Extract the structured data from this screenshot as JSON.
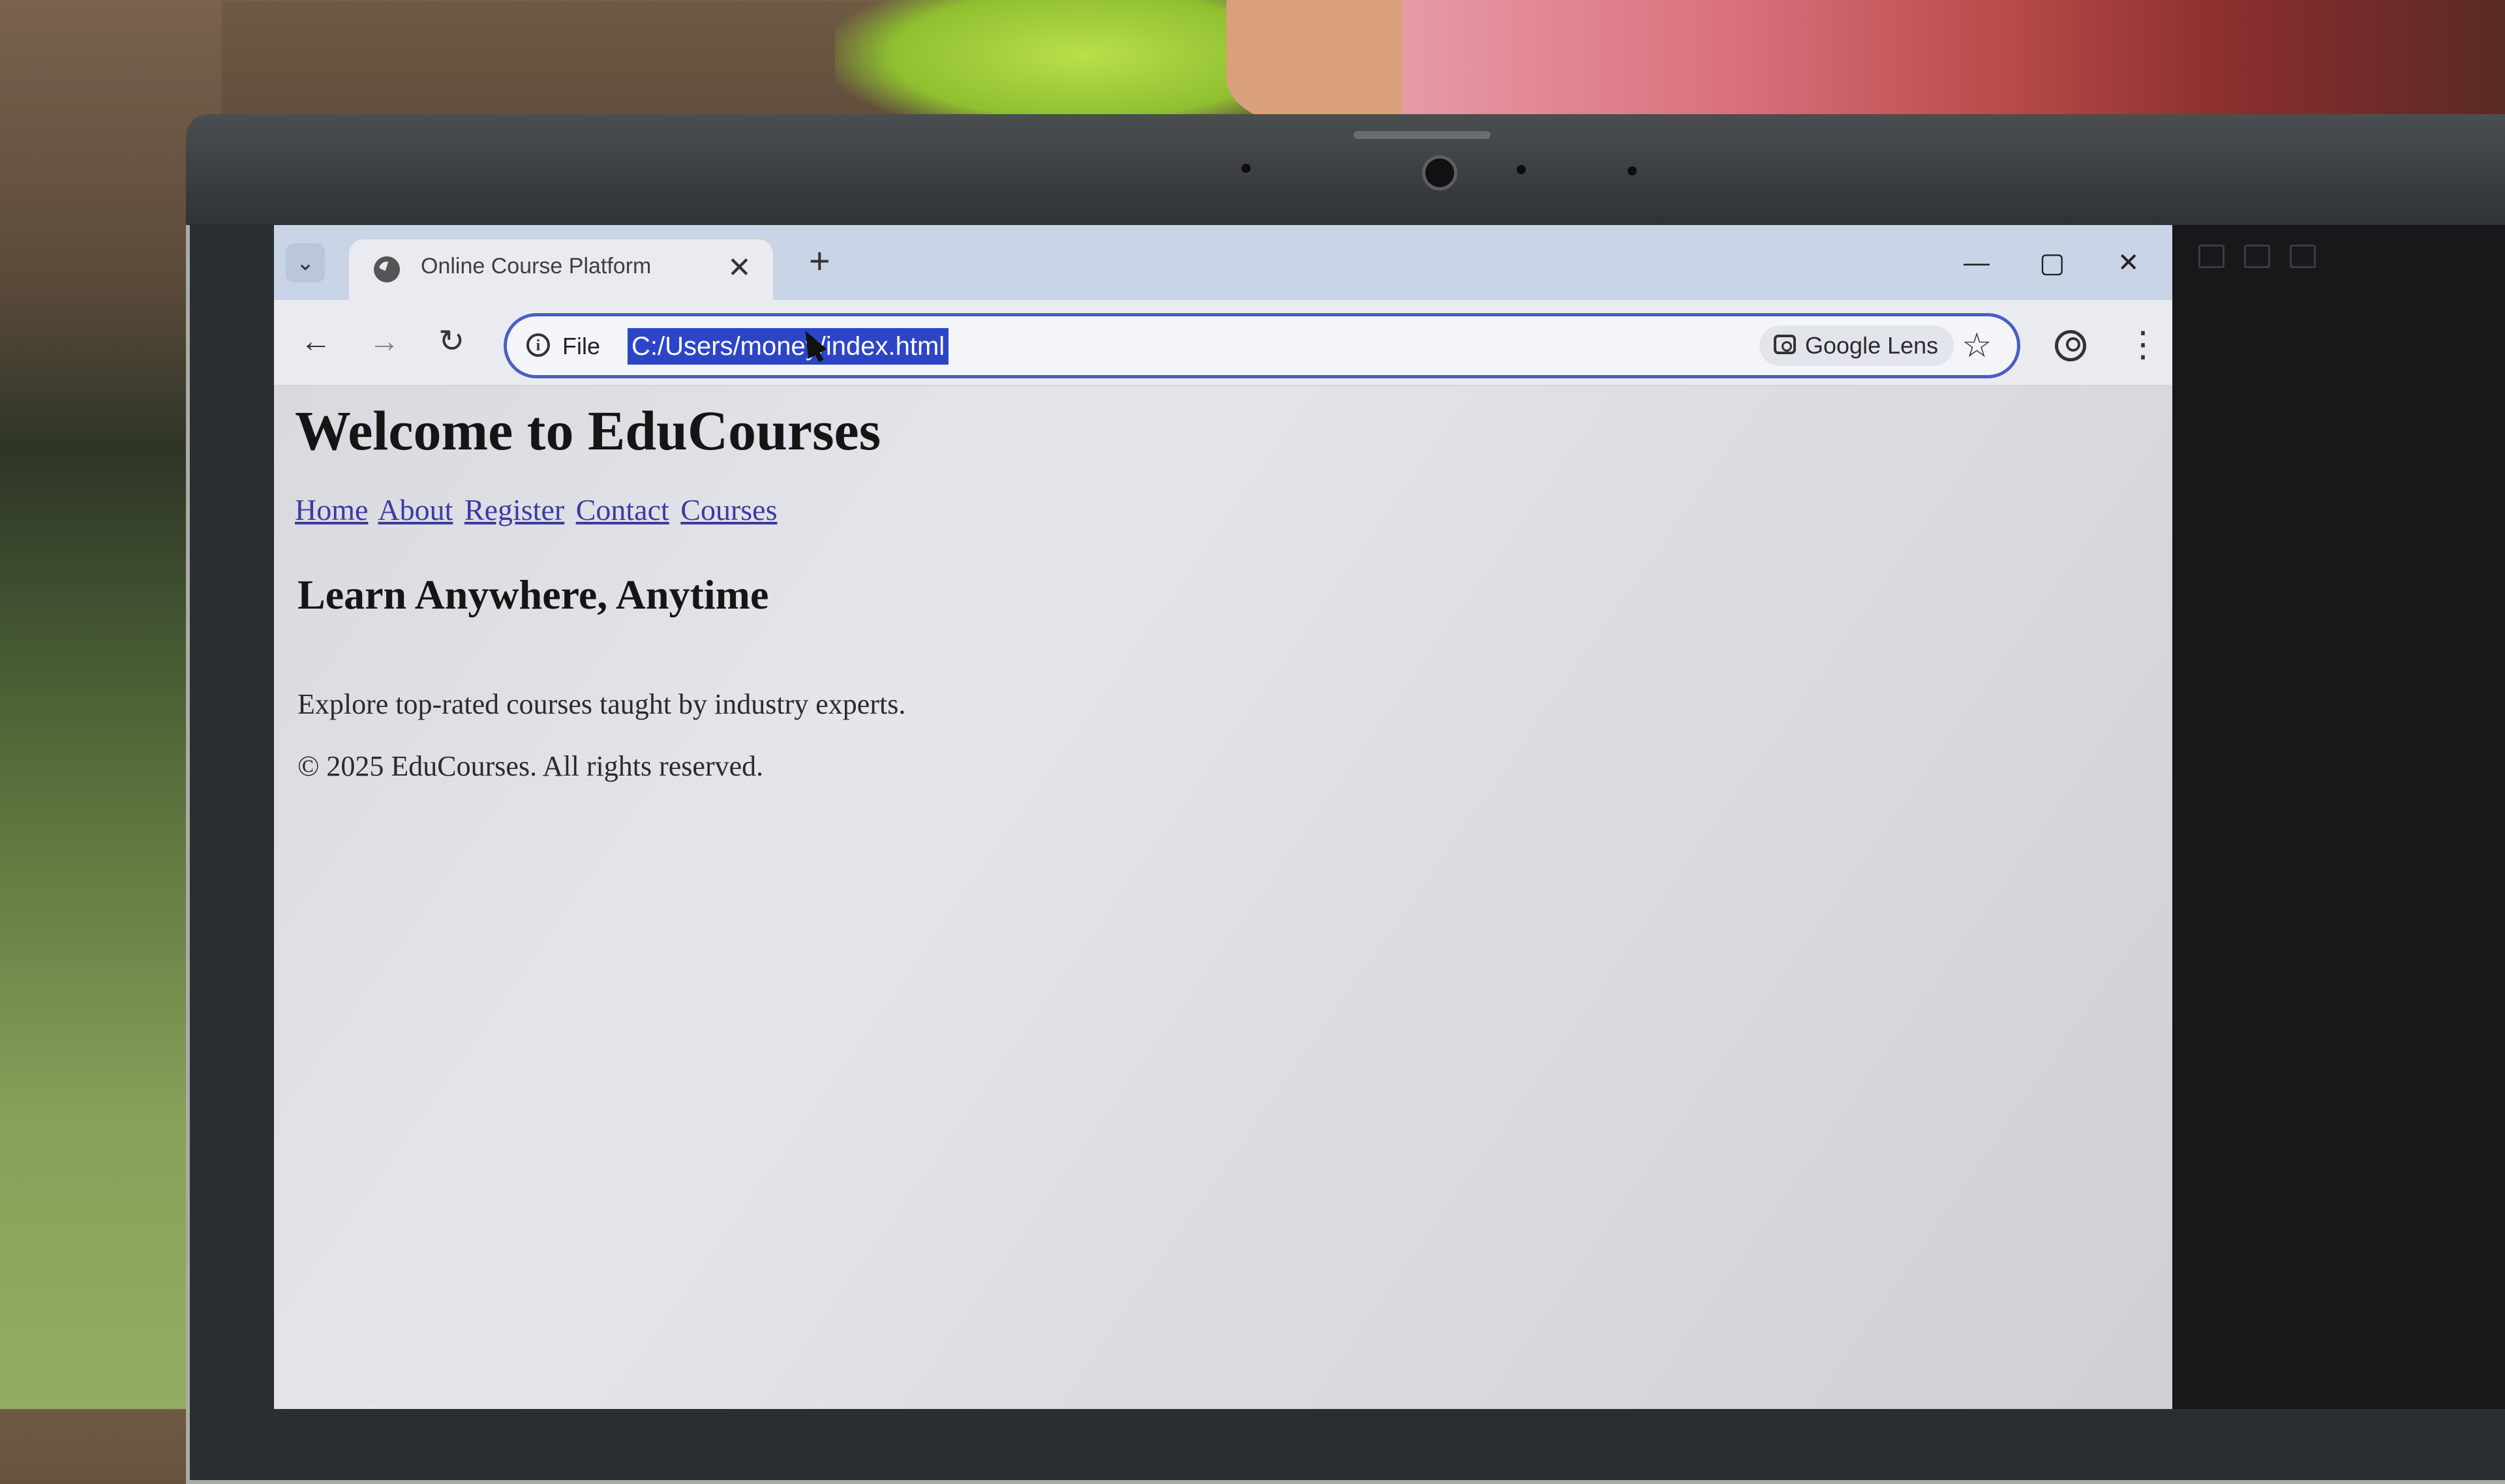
{
  "browser": {
    "tab": {
      "title": "Online Course Platform"
    },
    "address_bar": {
      "scheme_label": "File",
      "url": "C:/Users/money/index.html"
    },
    "lens_label": "Google Lens",
    "icons": {
      "tab_list": "chevron-down-icon",
      "close_tab": "close-icon",
      "new_tab": "plus-icon",
      "back": "arrow-left-icon",
      "forward": "arrow-right-icon",
      "reload": "reload-icon",
      "site_info": "info-icon",
      "bookmark": "star-icon",
      "profile": "profile-icon",
      "menu": "kebab-menu-icon",
      "minimize": "minimize-icon",
      "maximize": "maximize-icon",
      "close_window": "close-icon"
    },
    "accent_color": "#4a5ec4",
    "selection_color": "#2c45c8"
  },
  "page": {
    "heading": "Welcome to EduCourses",
    "nav": [
      "Home",
      "About",
      "Register",
      "Contact",
      "Courses"
    ],
    "subheading": "Learn Anywhere, Anytime",
    "lead": "Explore top-rated courses taught by industry experts.",
    "footer": "© 2025 EduCourses. All rights reserved.",
    "link_color": "#3b3aa6"
  }
}
